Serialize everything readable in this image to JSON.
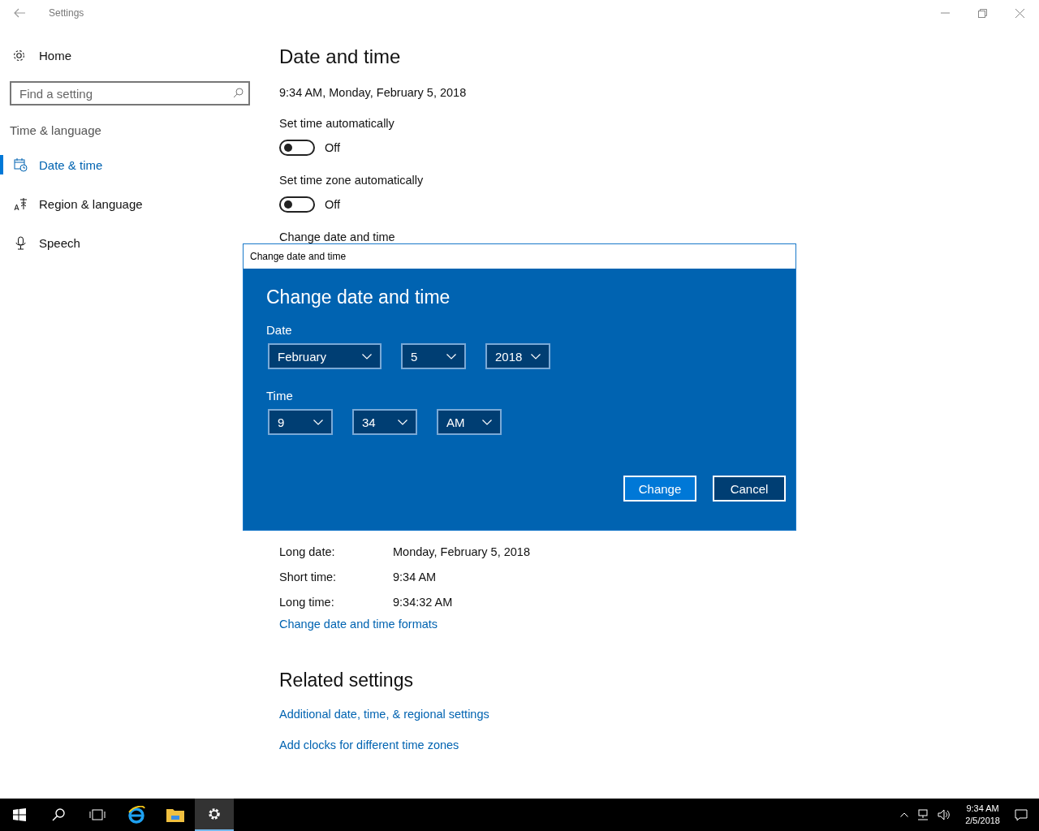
{
  "window": {
    "title": "Settings"
  },
  "sidebar": {
    "home": "Home",
    "search": {
      "placeholder": "Find a setting"
    },
    "section": "Time & language",
    "items": [
      {
        "label": "Date & time",
        "selected": true
      },
      {
        "label": "Region & language",
        "selected": false
      },
      {
        "label": "Speech",
        "selected": false
      }
    ]
  },
  "page": {
    "title": "Date and time",
    "current": "9:34 AM, Monday, February 5, 2018",
    "toggles": [
      {
        "label": "Set time automatically",
        "on": false,
        "state": "Off"
      },
      {
        "label": "Set time zone automatically",
        "on": false,
        "state": "Off"
      }
    ],
    "partial_heading": "Change date and time",
    "formats": [
      {
        "label": "Long date:",
        "value": "Monday, February 5, 2018"
      },
      {
        "label": "Short time:",
        "value": "9:34 AM"
      },
      {
        "label": "Long time:",
        "value": "9:34:32 AM"
      }
    ],
    "formats_link": "Change date and time formats",
    "related_title": "Related settings",
    "related_links": [
      "Additional date, time, & regional settings",
      "Add clocks for different time zones"
    ]
  },
  "dialog": {
    "title": "Change date and time",
    "heading": "Change date and time",
    "date_label": "Date",
    "date_fields": [
      "February",
      "5",
      "2018"
    ],
    "time_label": "Time",
    "time_fields": [
      "9",
      "34",
      "AM"
    ],
    "buttons": [
      {
        "label": "Change",
        "kind": "primary"
      },
      {
        "label": "Cancel",
        "kind": "secondary"
      }
    ]
  },
  "taskbar": {
    "items": [
      {
        "selected": false
      },
      {
        "selected": false
      },
      {
        "selected": false
      },
      {
        "selected": false
      },
      {
        "selected": false
      },
      {
        "selected": true
      }
    ],
    "clock": {
      "time": "9:34 AM",
      "date": "2/5/2018"
    }
  }
}
